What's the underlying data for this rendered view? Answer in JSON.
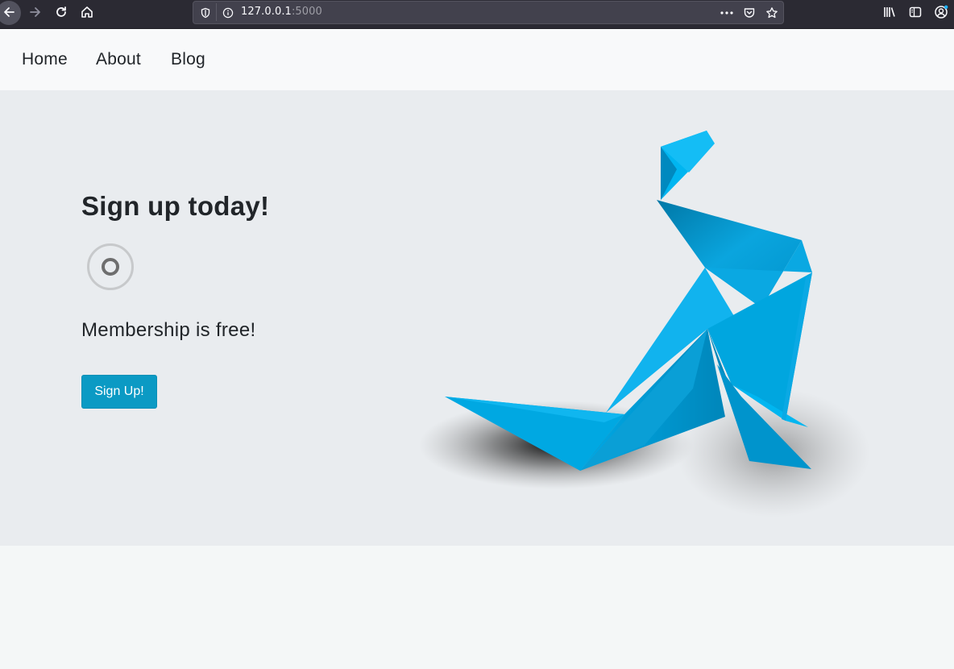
{
  "browser": {
    "url_host": "127.0.0.1",
    "url_port": ":5000",
    "icons": [
      "back-arrow-icon",
      "forward-arrow-icon",
      "reload-icon",
      "home-icon",
      "shield-icon",
      "info-icon",
      "more-dots-icon",
      "pocket-icon",
      "star-icon",
      "library-icon",
      "sidebar-icon",
      "account-icon"
    ]
  },
  "nav": {
    "links": [
      "Home",
      "About",
      "Blog"
    ]
  },
  "hero": {
    "title": "Sign up today!",
    "subtitle": "Membership is free!",
    "button_label": "Sign Up!",
    "radio_selected": true,
    "accent_color": "#0b9ac4",
    "image": "origami-bird"
  }
}
